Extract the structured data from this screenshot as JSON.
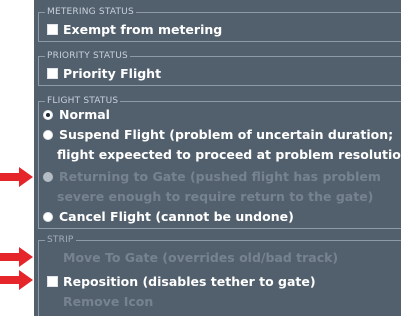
{
  "metering": {
    "title": "METERING STATUS",
    "exempt_label": "Exempt from metering",
    "exempt_checked": false
  },
  "priority": {
    "title": "PRIORITY STATUS",
    "priority_label": "Priority Flight",
    "priority_checked": false
  },
  "flight_status": {
    "title": "FLIGHT STATUS",
    "selected": "Normal",
    "options": [
      {
        "label": "Normal",
        "selected": true,
        "enabled": true
      },
      {
        "label": "Suspend Flight (problem of uncertain duration;",
        "label_cont": "flight expeected to proceed at problem resolution)",
        "selected": false,
        "enabled": true
      },
      {
        "label": "Returning to Gate (pushed flight has problem",
        "label_cont": "severe enough to require return to the gate)",
        "selected": false,
        "enabled": false
      },
      {
        "label": "Cancel Flight (cannot be undone)",
        "selected": false,
        "enabled": true
      }
    ]
  },
  "strip": {
    "title": "STRIP",
    "move_to_gate": "Move To Gate (overrides old/bad track)",
    "reposition_label": "Reposition (disables tether to gate)",
    "reposition_checked": false,
    "remove_icon": "Remove Icon"
  },
  "colors": {
    "panel_bg": "#52606e",
    "enabled_text": "#ffffff",
    "disabled_text": "#76838f",
    "arrow": "#e5252a"
  },
  "annotations": {
    "arrow_icon": "red-pointer-arrow-icon",
    "arrow_count": 3
  }
}
